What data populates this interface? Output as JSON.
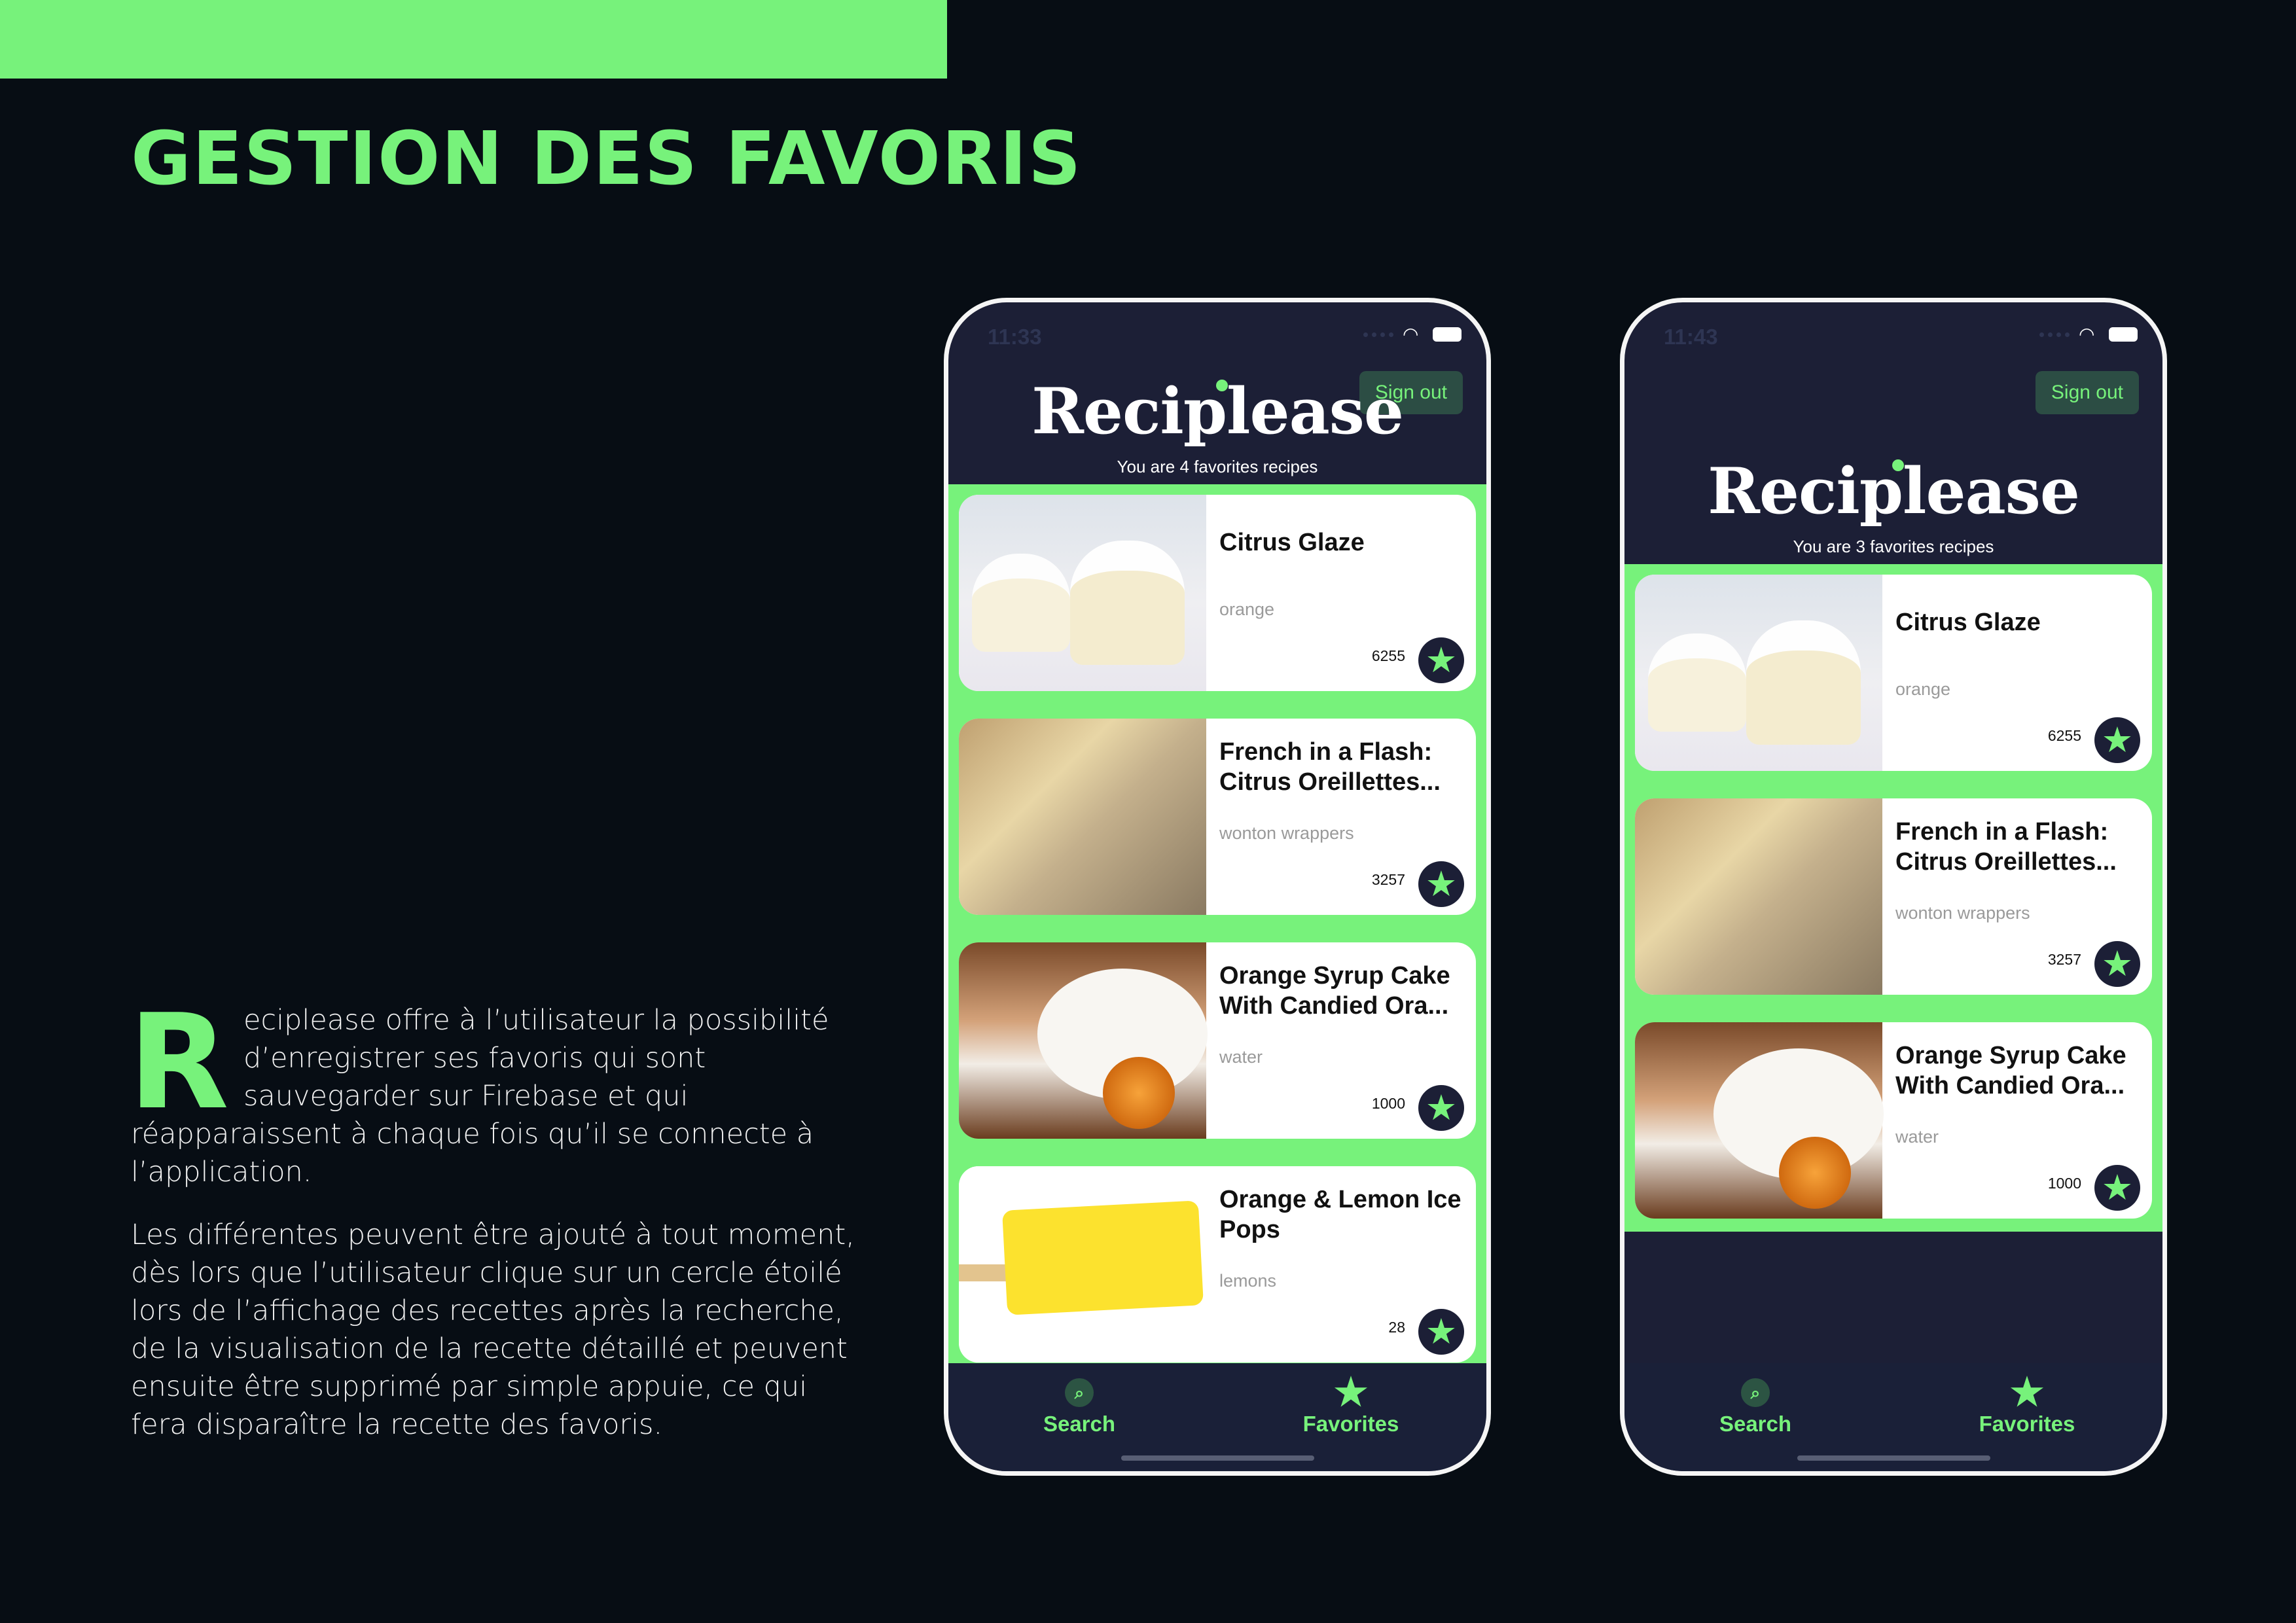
{
  "page": {
    "title": "GESTION DES FAVORIS",
    "dropcap": "R",
    "para1_rest": "eciplease offre à l’utilisateur la possibilité d’enregistrer ses favoris qui sont sauvegarder sur Firebase et qui réapparaissent à chaque fois qu’il se connecte à l’application.",
    "para2": "Les différentes peuvent être ajouté à tout moment, dès lors que l’utilisateur clique sur un cercle étoilé lors de l’affichage des recettes après la recherche, de la visualisation de la recette détaillé et peuvent ensuite être supprimé par simple appuie, ce qui fera disparaître la recette des favoris."
  },
  "colors": {
    "accent": "#77f27b",
    "background": "#070d14",
    "app_navy": "#1c1f36"
  },
  "phones": [
    {
      "time": "11:33",
      "sign_out": "Sign out",
      "logo": "Reciplease",
      "subtitle": "You are 4 favorites recipes",
      "recipes": [
        {
          "title": "Citrus Glaze",
          "ingredient": "orange",
          "count": "6255",
          "image": "cupcakes"
        },
        {
          "title": "French in a Flash: Citrus Oreillettes...",
          "ingredient": "wonton wrappers",
          "count": "3257",
          "image": "pastry"
        },
        {
          "title": "Orange Syrup Cake With Candied Ora...",
          "ingredient": "water",
          "count": "1000",
          "image": "cake"
        },
        {
          "title": "Orange & Lemon Ice Pops",
          "ingredient": "lemons",
          "count": "28",
          "image": "ice-pop"
        }
      ],
      "tabs": {
        "search": "Search",
        "favorites": "Favorites"
      }
    },
    {
      "time": "11:43",
      "sign_out": "Sign out",
      "logo": "Reciplease",
      "subtitle": "You are 3 favorites recipes",
      "recipes": [
        {
          "title": "Citrus Glaze",
          "ingredient": "orange",
          "count": "6255",
          "image": "cupcakes"
        },
        {
          "title": "French in a Flash: Citrus Oreillettes...",
          "ingredient": "wonton wrappers",
          "count": "3257",
          "image": "pastry"
        },
        {
          "title": "Orange Syrup Cake With Candied Ora...",
          "ingredient": "water",
          "count": "1000",
          "image": "cake"
        }
      ],
      "tabs": {
        "search": "Search",
        "favorites": "Favorites"
      }
    }
  ]
}
